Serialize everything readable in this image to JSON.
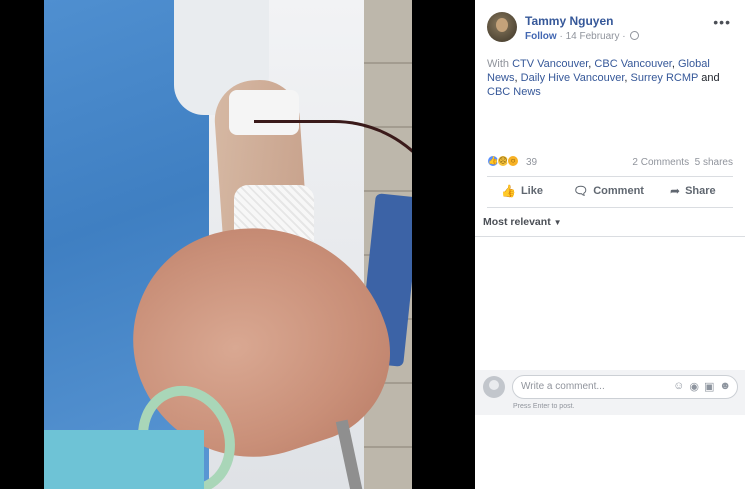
{
  "post": {
    "author": "Tammy Nguyen",
    "follow_label": "Follow",
    "date": "14 February",
    "text_lead": "With ",
    "tags": [
      "CTV Vancouver",
      "CBC Vancouver",
      "Global News",
      "Daily Hive Vancouver",
      "Surrey RCMP",
      "CBC News"
    ],
    "sep": ", ",
    "and_word": " and ",
    "more_label": "•••"
  },
  "stats": {
    "reaction_icons": [
      "like-icon",
      "sad-icon",
      "wow-icon"
    ],
    "reaction_count": "39",
    "comments": "2 Comments",
    "shares": "5 shares"
  },
  "actions": {
    "like": "Like",
    "comment": "Comment",
    "share": "Share"
  },
  "comments": {
    "sort_label": "Most relevant",
    "placeholder": "Write a comment...",
    "hint": "Press Enter to post."
  },
  "colors": {
    "link": "#365899",
    "accent": "#4267b2",
    "muted": "#90949c"
  }
}
